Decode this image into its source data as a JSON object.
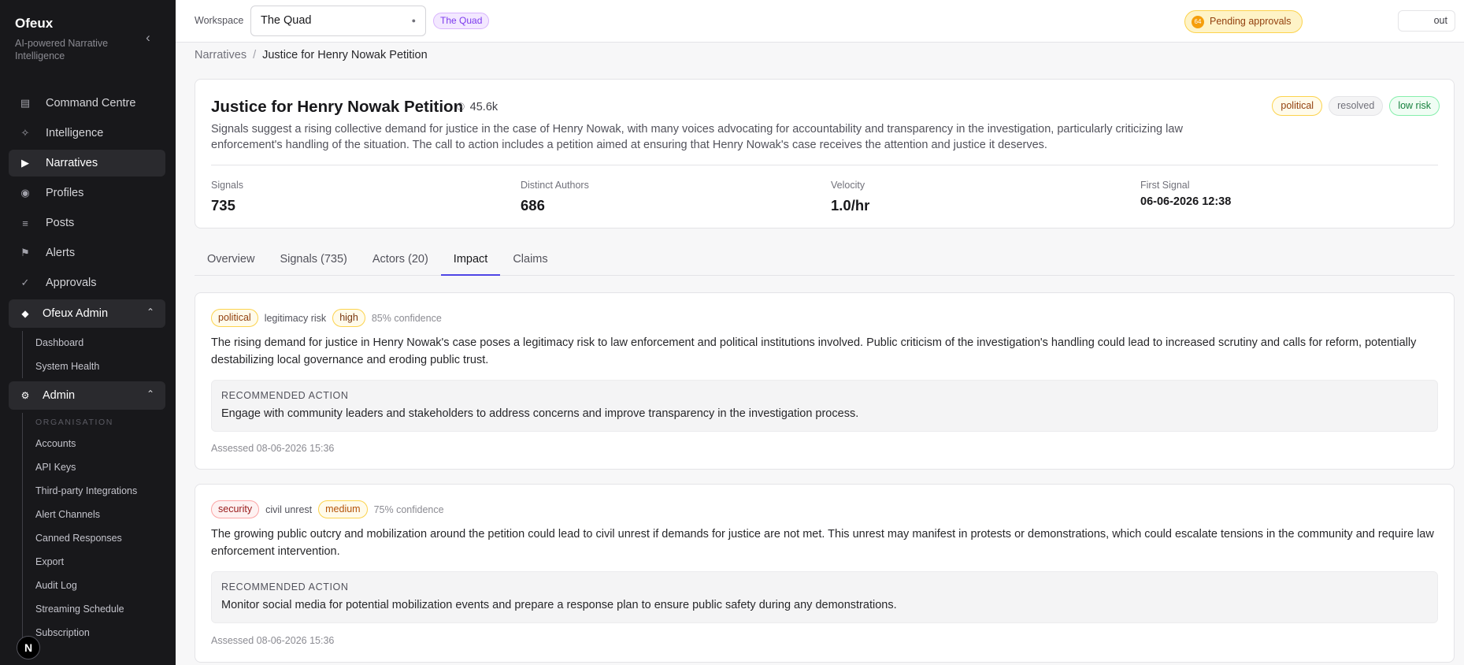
{
  "brand": {
    "name": "Ofeux",
    "subtitle": "AI-powered Narrative Intelligence"
  },
  "sidebar": {
    "items": [
      {
        "label": "Command Centre",
        "icon": "grid-icon"
      },
      {
        "label": "Intelligence",
        "icon": "sparkle-icon"
      },
      {
        "label": "Narratives",
        "icon": "play-icon"
      },
      {
        "label": "Profiles",
        "icon": "user-icon"
      },
      {
        "label": "Posts",
        "icon": "list-icon"
      },
      {
        "label": "Alerts",
        "icon": "flag-icon"
      },
      {
        "label": "Approvals",
        "icon": "check-icon"
      }
    ],
    "groups": {
      "ofeux_admin": {
        "label": "Ofeux Admin",
        "items": [
          "Dashboard",
          "System Health"
        ]
      },
      "admin": {
        "label": "Admin",
        "section": "ORGANISATION",
        "items": [
          "Accounts",
          "API Keys",
          "Third-party Integrations",
          "Alert Channels",
          "Canned Responses",
          "Export",
          "Audit Log",
          "Streaming Schedule",
          "Subscription"
        ]
      }
    },
    "avatar": "N"
  },
  "topbar": {
    "workspace_label": "Workspace",
    "workspace_value": "The Quad",
    "workspace_badge": "The Quad",
    "pending_count": "64",
    "pending_label": "Pending approvals",
    "logout_label": "out"
  },
  "breadcrumb": {
    "parent": "Narratives",
    "current": "Justice for Henry Nowak Petition"
  },
  "narrative": {
    "title": "Justice for Henry Nowak Petition",
    "views": "45.6k",
    "description": "Signals suggest a rising collective demand for justice in the case of Henry Nowak, with many voices advocating for accountability and transparency in the investigation, particularly criticizing law enforcement's handling of the situation. The call to action includes a petition aimed at ensuring that Henry Nowak's case receives the attention and justice it deserves.",
    "tags": [
      "political",
      "resolved",
      "low risk"
    ],
    "stats": {
      "signals": {
        "label": "Signals",
        "value": "735"
      },
      "authors": {
        "label": "Distinct Authors",
        "value": "686"
      },
      "velocity": {
        "label": "Velocity",
        "value": "1.0/hr"
      },
      "first": {
        "label": "First Signal",
        "value": "06-06-2026 12:38"
      }
    }
  },
  "tabs": [
    "Overview",
    "Signals (735)",
    "Actors (20)",
    "Impact",
    "Claims"
  ],
  "impacts": [
    {
      "category": "political",
      "risk_type": "legitimacy risk",
      "severity": "high",
      "confidence": "85% confidence",
      "text": "The rising demand for justice in Henry Nowak's case poses a legitimacy risk to law enforcement and political institutions involved. Public criticism of the investigation's handling could lead to increased scrutiny and calls for reform, potentially destabilizing local governance and eroding public trust.",
      "rec_label": "RECOMMENDED ACTION",
      "rec_text": "Engage with community leaders and stakeholders to address concerns and improve transparency in the investigation process.",
      "assessed": "Assessed 08-06-2026 15:36"
    },
    {
      "category": "security",
      "risk_type": "civil unrest",
      "severity": "medium",
      "confidence": "75% confidence",
      "text": "The growing public outcry and mobilization around the petition could lead to civil unrest if demands for justice are not met. This unrest may manifest in protests or demonstrations, which could escalate tensions in the community and require law enforcement intervention.",
      "rec_label": "RECOMMENDED ACTION",
      "rec_text": "Monitor social media for potential mobilization events and prepare a response plan to ensure public safety during any demonstrations.",
      "assessed": "Assessed 08-06-2026 15:36"
    }
  ],
  "colors": {
    "sidebar_bg": "#18181b",
    "accent": "#4f46e5",
    "pending": "#f59e0b"
  }
}
